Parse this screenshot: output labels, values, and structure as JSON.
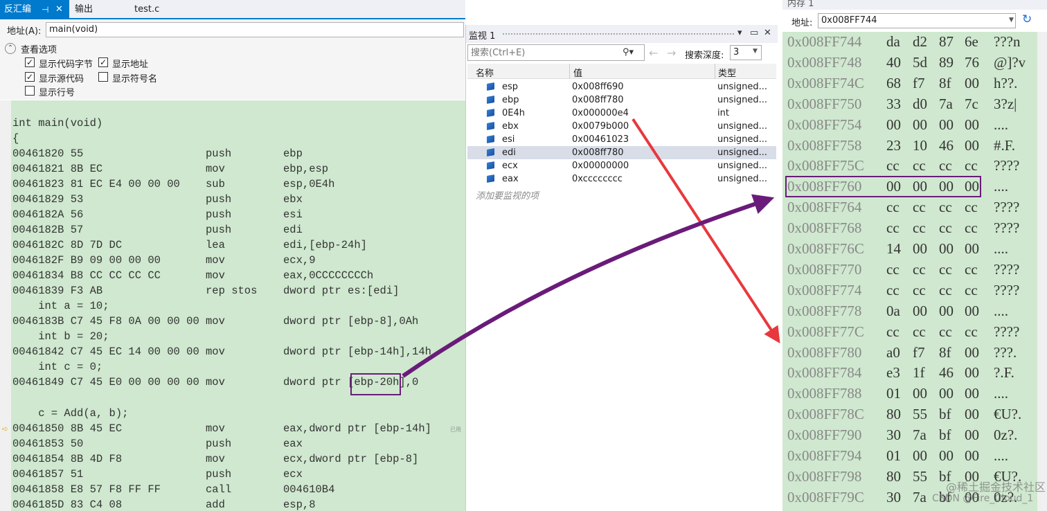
{
  "disassembly": {
    "tabs": [
      {
        "label": "反汇编",
        "pin": "⊣",
        "close": "✕"
      },
      {
        "label": "输出"
      },
      {
        "label": "test.c"
      }
    ],
    "address_label": "地址(A):",
    "address_value": "main(void)",
    "options_title": "查看选项",
    "options": [
      {
        "label": "显示代码字节",
        "checked": true
      },
      {
        "label": "显示地址",
        "checked": true
      },
      {
        "label": "显示源代码",
        "checked": true
      },
      {
        "label": "显示符号名",
        "checked": false
      },
      {
        "label": "显示行号",
        "checked": false
      }
    ],
    "lines": [
      {
        "code": "int main(void)",
        "mnemonic": "",
        "operand": ""
      },
      {
        "code": "{",
        "mnemonic": "",
        "operand": ""
      },
      {
        "code": "00461820 55",
        "mnemonic": "push",
        "operand": "ebp"
      },
      {
        "code": "00461821 8B EC",
        "mnemonic": "mov",
        "operand": "ebp,esp"
      },
      {
        "code": "00461823 81 EC E4 00 00 00",
        "mnemonic": "sub",
        "operand": "esp,0E4h"
      },
      {
        "code": "00461829 53",
        "mnemonic": "push",
        "operand": "ebx"
      },
      {
        "code": "0046182A 56",
        "mnemonic": "push",
        "operand": "esi"
      },
      {
        "code": "0046182B 57",
        "mnemonic": "push",
        "operand": "edi"
      },
      {
        "code": "0046182C 8D 7D DC",
        "mnemonic": "lea",
        "operand": "edi,[ebp-24h]"
      },
      {
        "code": "0046182F B9 09 00 00 00",
        "mnemonic": "mov",
        "operand": "ecx,9"
      },
      {
        "code": "00461834 B8 CC CC CC CC",
        "mnemonic": "mov",
        "operand": "eax,0CCCCCCCCh"
      },
      {
        "code": "00461839 F3 AB",
        "mnemonic": "rep stos",
        "operand": "dword ptr es:[edi]"
      },
      {
        "code": "    int a = 10;",
        "mnemonic": "",
        "operand": ""
      },
      {
        "code": "0046183B C7 45 F8 0A 00 00 00",
        "mnemonic": "mov",
        "operand": "dword ptr [ebp-8],0Ah"
      },
      {
        "code": "    int b = 20;",
        "mnemonic": "",
        "operand": ""
      },
      {
        "code": "00461842 C7 45 EC 14 00 00 00",
        "mnemonic": "mov",
        "operand": "dword ptr [ebp-14h],14h"
      },
      {
        "code": "    int c = 0;",
        "mnemonic": "",
        "operand": ""
      },
      {
        "code": "00461849 C7 45 E0 00 00 00 00",
        "mnemonic": "mov",
        "operand": "dword ptr [ebp-20h],0"
      },
      {
        "code": "",
        "mnemonic": "",
        "operand": ""
      },
      {
        "code": "    c = Add(a, b);",
        "mnemonic": "",
        "operand": ""
      },
      {
        "code": "00461850 8B 45 EC",
        "mnemonic": "mov",
        "operand": "eax,dword ptr [ebp-14h]"
      },
      {
        "code": "00461853 50",
        "mnemonic": "push",
        "operand": "eax"
      },
      {
        "code": "00461854 8B 4D F8",
        "mnemonic": "mov",
        "operand": "ecx,dword ptr [ebp-8]"
      },
      {
        "code": "00461857 51",
        "mnemonic": "push",
        "operand": "ecx"
      },
      {
        "code": "00461858 E8 57 F8 FF FF",
        "mnemonic": "call",
        "operand": "004610B4"
      },
      {
        "code": "0046185D 83 C4 08",
        "mnemonic": "add",
        "operand": "esp,8"
      }
    ],
    "elapsed_note": "已用"
  },
  "watch": {
    "title": "监视 1",
    "search_placeholder": "搜索(Ctrl+E)",
    "depth_label": "搜索深度:",
    "depth_value": "3",
    "columns": [
      "名称",
      "值",
      "类型"
    ],
    "rows": [
      {
        "name": "esp",
        "value": "0x008ff690",
        "type": "unsigned..."
      },
      {
        "name": "ebp",
        "value": "0x008ff780",
        "type": "unsigned..."
      },
      {
        "name": "0E4h",
        "value": "0x000000e4",
        "type": "int"
      },
      {
        "name": "ebx",
        "value": "0x0079b000",
        "type": "unsigned..."
      },
      {
        "name": "esi",
        "value": "0x00461023",
        "type": "unsigned..."
      },
      {
        "name": "edi",
        "value": "0x008ff780",
        "type": "unsigned...",
        "selected": true
      },
      {
        "name": "ecx",
        "value": "0x00000000",
        "type": "unsigned..."
      },
      {
        "name": "eax",
        "value": "0xcccccccc",
        "type": "unsigned..."
      }
    ],
    "add_item": "添加要监视的项"
  },
  "memory": {
    "title": "内存 1",
    "address_label": "地址:",
    "address_value": "0x008FF744",
    "rows": [
      {
        "addr": "0x008FF744",
        "bytes": [
          "da",
          "d2",
          "87",
          "6e"
        ],
        "chars": "???n"
      },
      {
        "addr": "0x008FF748",
        "bytes": [
          "40",
          "5d",
          "89",
          "76"
        ],
        "chars": "@]?v"
      },
      {
        "addr": "0x008FF74C",
        "bytes": [
          "68",
          "f7",
          "8f",
          "00"
        ],
        "chars": "h??."
      },
      {
        "addr": "0x008FF750",
        "bytes": [
          "33",
          "d0",
          "7a",
          "7c"
        ],
        "chars": "3?z|"
      },
      {
        "addr": "0x008FF754",
        "bytes": [
          "00",
          "00",
          "00",
          "00"
        ],
        "chars": "...."
      },
      {
        "addr": "0x008FF758",
        "bytes": [
          "23",
          "10",
          "46",
          "00"
        ],
        "chars": "#.F."
      },
      {
        "addr": "0x008FF75C",
        "bytes": [
          "cc",
          "cc",
          "cc",
          "cc"
        ],
        "chars": "????"
      },
      {
        "addr": "0x008FF760",
        "bytes": [
          "00",
          "00",
          "00",
          "00"
        ],
        "chars": "....",
        "highlight": true
      },
      {
        "addr": "0x008FF764",
        "bytes": [
          "cc",
          "cc",
          "cc",
          "cc"
        ],
        "chars": "????"
      },
      {
        "addr": "0x008FF768",
        "bytes": [
          "cc",
          "cc",
          "cc",
          "cc"
        ],
        "chars": "????"
      },
      {
        "addr": "0x008FF76C",
        "bytes": [
          "14",
          "00",
          "00",
          "00"
        ],
        "chars": "...."
      },
      {
        "addr": "0x008FF770",
        "bytes": [
          "cc",
          "cc",
          "cc",
          "cc"
        ],
        "chars": "????"
      },
      {
        "addr": "0x008FF774",
        "bytes": [
          "cc",
          "cc",
          "cc",
          "cc"
        ],
        "chars": "????"
      },
      {
        "addr": "0x008FF778",
        "bytes": [
          "0a",
          "00",
          "00",
          "00"
        ],
        "chars": "...."
      },
      {
        "addr": "0x008FF77C",
        "bytes": [
          "cc",
          "cc",
          "cc",
          "cc"
        ],
        "chars": "????"
      },
      {
        "addr": "0x008FF780",
        "bytes": [
          "a0",
          "f7",
          "8f",
          "00"
        ],
        "chars": "???."
      },
      {
        "addr": "0x008FF784",
        "bytes": [
          "e3",
          "1f",
          "46",
          "00"
        ],
        "chars": "?.F."
      },
      {
        "addr": "0x008FF788",
        "bytes": [
          "01",
          "00",
          "00",
          "00"
        ],
        "chars": "...."
      },
      {
        "addr": "0x008FF78C",
        "bytes": [
          "80",
          "55",
          "bf",
          "00"
        ],
        "chars": "€U?."
      },
      {
        "addr": "0x008FF790",
        "bytes": [
          "30",
          "7a",
          "bf",
          "00"
        ],
        "chars": "0z?."
      },
      {
        "addr": "0x008FF794",
        "bytes": [
          "01",
          "00",
          "00",
          "00"
        ],
        "chars": "...."
      },
      {
        "addr": "0x008FF798",
        "bytes": [
          "80",
          "55",
          "bf",
          "00"
        ],
        "chars": "€U?."
      },
      {
        "addr": "0x008FF79C",
        "bytes": [
          "30",
          "7a",
          "bf",
          "00"
        ],
        "chars": "0z?."
      }
    ]
  },
  "watermark": {
    "line1": "@稀土掘金技术社区",
    "line2": "CSDN @Fire_Cloud_1"
  },
  "colors": {
    "accent": "#007acc",
    "code_bg": "#cfe8cf",
    "highlight_box": "#6a1b7a",
    "arrow_red": "#e8383d",
    "arrow_purple": "#6a1b7a"
  }
}
